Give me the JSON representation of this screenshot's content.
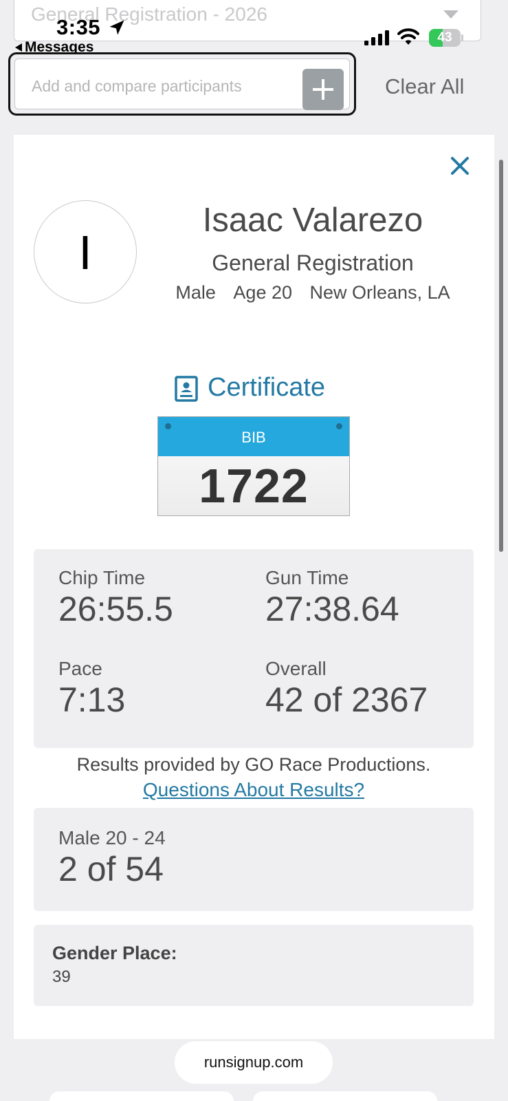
{
  "event_select": {
    "value": "General Registration - 2026"
  },
  "status_bar": {
    "time": "3:35",
    "back_label": "Messages",
    "battery": "43",
    "battery_level": 0.43
  },
  "compare": {
    "placeholder": "Add and compare participants",
    "clear_label": "Clear All"
  },
  "participant": {
    "initial": "I",
    "name": "Isaac Valarezo",
    "division": "General Registration",
    "gender": "Male",
    "age": "Age 20",
    "location": "New Orleans, LA"
  },
  "certificate_label": "Certificate",
  "bib": {
    "label": "BIB",
    "number": "1722"
  },
  "stats": {
    "chip_time_label": "Chip Time",
    "chip_time": "26:55.5",
    "gun_time_label": "Gun Time",
    "gun_time": "27:38.64",
    "pace_label": "Pace",
    "pace": "7:13",
    "overall_label": "Overall",
    "overall": "42 of 2367"
  },
  "results_note": "Results provided by GO Race Productions.",
  "questions_link": "Questions About Results?",
  "age_group": {
    "label": "Male 20 - 24",
    "value": "2 of 54"
  },
  "gender_place": {
    "label": "Gender Place:",
    "value": "39"
  },
  "url_pill": "runsignup.com",
  "colors": {
    "accent": "#2379a3",
    "bib_blue": "#25a8dd",
    "battery_green": "#34c759"
  }
}
